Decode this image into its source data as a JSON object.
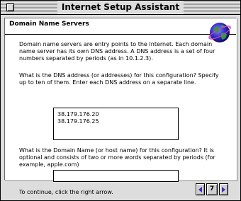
{
  "window": {
    "title": "Internet Setup Assistant"
  },
  "header": {
    "title": "Domain Name Servers",
    "logo_icon": "globe-icon"
  },
  "content": {
    "intro": "Domain name servers are entry points to the Internet.  Each domain name server has its own DNS address. A DNS address is a set of four numbers separated by periods (as in 10.1.2.3).",
    "dns_prompt": "What is the DNS address (or addresses) for this configuration?  Specify up to ten of them.  Enter each DNS address on a separate line.",
    "dns_addresses": [
      "38.179.176.20",
      "38.179.176.25"
    ],
    "domain_prompt": "What is the Domain Name (or host name) for this configuration?  It is optional and consists of two or more words separated by periods (for example, apple.com)",
    "domain_value": "",
    "continue_text": "To continue, click the right arrow."
  },
  "navigation": {
    "previous_icon": "left-arrow-icon",
    "next_icon": "right-arrow-icon",
    "page_number": "7"
  },
  "colors": {
    "arrow": "#3a2fb8",
    "window_bg": "#dddddd",
    "panel_bg": "#ffffff"
  }
}
